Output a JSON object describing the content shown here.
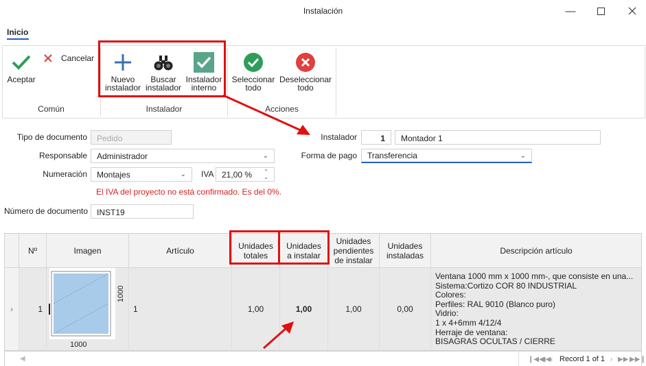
{
  "window": {
    "title": "Instalación"
  },
  "tabs": [
    {
      "label": "Inicio"
    }
  ],
  "ribbon": {
    "aceptar": "Aceptar",
    "cancelar": "Cancelar",
    "nuevo_l1": "Nuevo",
    "nuevo_l2": "instalador",
    "buscar_l1": "Buscar",
    "buscar_l2": "instalador",
    "interno_l1": "Instalador",
    "interno_l2": "interno",
    "selall_l1": "Seleccionar",
    "selall_l2": "todo",
    "desel_l1": "Deseleccionar",
    "desel_l2": "todo",
    "groups": {
      "comun": "Común",
      "instalador": "Instalador",
      "acciones": "Acciones"
    }
  },
  "form": {
    "tipo_label": "Tipo de documento",
    "tipo_value": "Pedido",
    "resp_label": "Responsable",
    "resp_value": "Administrador",
    "num_label": "Numeración",
    "num_value": "Montajes",
    "iva_label": "IVA",
    "iva_value": "21,00 %",
    "iva_warning": "El IVA del proyecto no está confirmado. Es del 0%.",
    "numdoc_label": "Número de documento",
    "numdoc_value": "INST19",
    "instalador_label": "Instalador",
    "instalador_id": "1",
    "instalador_name": "Montador 1",
    "pago_label": "Forma de pago",
    "pago_value": "Transferencia"
  },
  "table": {
    "headers": {
      "n": "Nº",
      "imagen": "Imagen",
      "articulo": "Artículo",
      "totales_l1": "Unidades",
      "totales_l2": "totales",
      "ainstalar_l1": "Unidades",
      "ainstalar_l2": "a instalar",
      "pend_l1": "Unidades",
      "pend_l2": "pendientes",
      "pend_l3": "de instalar",
      "inst_l1": "Unidades",
      "inst_l2": "instaladas",
      "desc": "Descripción artículo"
    },
    "rows": [
      {
        "n": "1",
        "image_width": "1000",
        "image_height": "1000",
        "articulo": "1",
        "totales": "1,00",
        "a_instalar": "1,00",
        "pendientes": "1,00",
        "instaladas": "0,00",
        "desc": "Ventana 1000 mm x 1000 mm-, que consiste en una...\nSistema:Cortizo COR 80 INDUSTRIAL\nColores:\nPerfiles: RAL 9010 (Blanco puro)\nVidrio:\n1 x 4+6mm 4/12/4\nHerraje de ventana:\nBISAGRAS OCULTAS / CIERRE"
      }
    ]
  },
  "footer": {
    "record": "Record 1 of 1"
  },
  "colors": {
    "accent": "#1f5fbf",
    "highlight": "#e01010",
    "green": "#2e9e5a",
    "red": "#e04040"
  }
}
